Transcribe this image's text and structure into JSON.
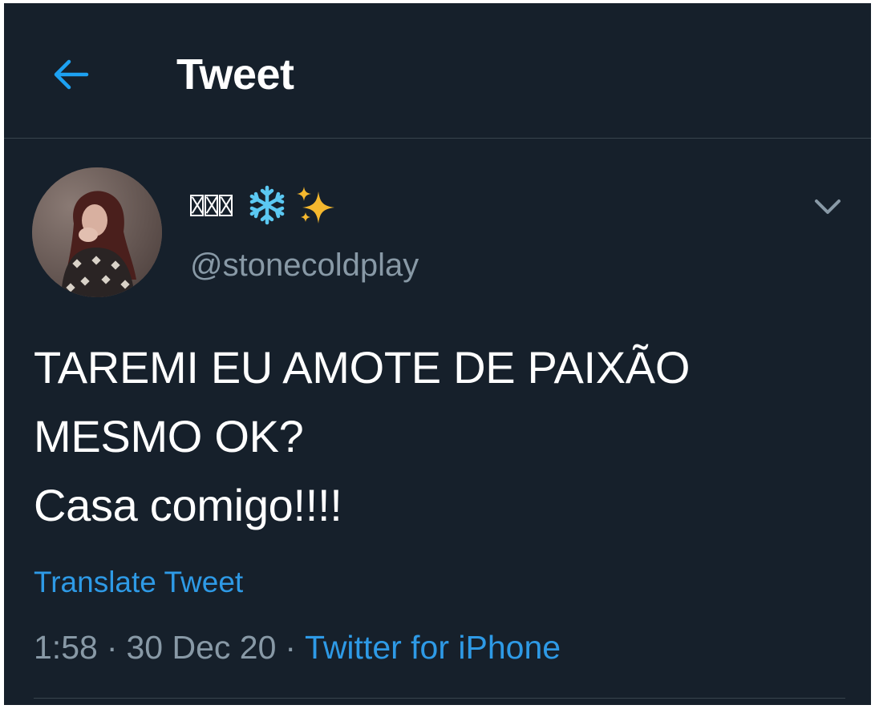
{
  "header": {
    "title": "Tweet",
    "back_icon": "arrow-left-icon",
    "accent_color": "#1da1f2"
  },
  "tweet": {
    "author": {
      "display_name_emojis": [
        "snowflake",
        "sparkles"
      ],
      "handle": "@stonecoldplay",
      "avatar": "avatar-photo"
    },
    "text_lines": [
      "TAREMI EU AMOTE DE PAIXÃO",
      "MESMO OK?",
      "Casa comigo!!!!"
    ],
    "translate_label": "Translate Tweet",
    "time": "1:58",
    "separator": "·",
    "date": "30 Dec 20",
    "source": "Twitter for iPhone",
    "more_icon": "chevron-down-icon"
  },
  "colors": {
    "background": "#16202b",
    "divider": "#38444d",
    "secondary_text": "#8899a6",
    "link": "#2e9ae6"
  }
}
